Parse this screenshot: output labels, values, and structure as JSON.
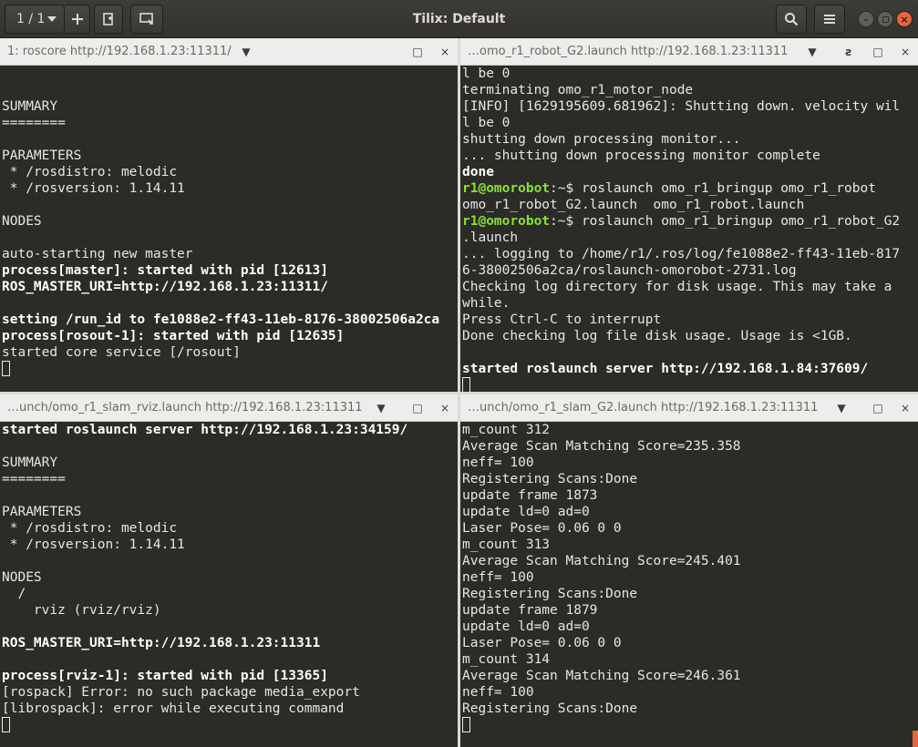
{
  "header": {
    "session_selector": "1 / 1",
    "title": "Tilix: Default"
  },
  "panes": {
    "top_left": {
      "title": "1: roscore http://192.168.1.23:11311/",
      "lines": [
        {
          "t": "",
          "s": ""
        },
        {
          "t": "",
          "s": ""
        },
        {
          "t": "SUMMARY",
          "s": ""
        },
        {
          "t": "========",
          "s": ""
        },
        {
          "t": "",
          "s": ""
        },
        {
          "t": "PARAMETERS",
          "s": ""
        },
        {
          "t": " * /rosdistro: melodic",
          "s": ""
        },
        {
          "t": " * /rosversion: 1.14.11",
          "s": ""
        },
        {
          "t": "",
          "s": ""
        },
        {
          "t": "NODES",
          "s": ""
        },
        {
          "t": "",
          "s": ""
        },
        {
          "t": "auto-starting new master",
          "s": ""
        },
        {
          "t": "process[master]: started with pid [12613]",
          "s": "b"
        },
        {
          "t": "ROS_MASTER_URI=http://192.168.1.23:11311/",
          "s": "b"
        },
        {
          "t": "",
          "s": ""
        },
        {
          "t": "setting /run_id to fe1088e2-ff43-11eb-8176-38002506a2ca",
          "s": "b"
        },
        {
          "t": "process[rosout-1]: started with pid [12635]",
          "s": "b"
        },
        {
          "t": "started core service [/rosout]",
          "s": ""
        }
      ]
    },
    "top_right": {
      "title": "…omo_r1_robot_G2.launch http://192.168.1.23:11311",
      "lines": [
        {
          "t": "l be 0",
          "s": ""
        },
        {
          "t": "terminating omo_r1_motor_node",
          "s": ""
        },
        {
          "t": "[INFO] [1629195609.681962]: Shutting down. velocity wil",
          "s": ""
        },
        {
          "t": "l be 0",
          "s": ""
        },
        {
          "t": "shutting down processing monitor...",
          "s": ""
        },
        {
          "t": "... shutting down processing monitor complete",
          "s": ""
        },
        {
          "t": "done",
          "s": "b"
        },
        {
          "p": "r1@omorobot",
          "t": ":~$ roslaunch omo_r1_bringup omo_r1_robot",
          "s": ""
        },
        {
          "t": "omo_r1_robot_G2.launch  omo_r1_robot.launch",
          "s": ""
        },
        {
          "p": "r1@omorobot",
          "t": ":~$ roslaunch omo_r1_bringup omo_r1_robot_G2",
          "s": ""
        },
        {
          "t": ".launch",
          "s": ""
        },
        {
          "t": "... logging to /home/r1/.ros/log/fe1088e2-ff43-11eb-817",
          "s": ""
        },
        {
          "t": "6-38002506a2ca/roslaunch-omorobot-2731.log",
          "s": ""
        },
        {
          "t": "Checking log directory for disk usage. This may take a",
          "s": ""
        },
        {
          "t": "while.",
          "s": ""
        },
        {
          "t": "Press Ctrl-C to interrupt",
          "s": ""
        },
        {
          "t": "Done checking log file disk usage. Usage is <1GB.",
          "s": ""
        },
        {
          "t": "",
          "s": ""
        },
        {
          "t": "started roslaunch server http://192.168.1.84:37609/",
          "s": "b"
        }
      ]
    },
    "bottom_left": {
      "title": "…unch/omo_r1_slam_rviz.launch http://192.168.1.23:11311",
      "lines": [
        {
          "t": "started roslaunch server http://192.168.1.23:34159/",
          "s": "b"
        },
        {
          "t": "",
          "s": ""
        },
        {
          "t": "SUMMARY",
          "s": ""
        },
        {
          "t": "========",
          "s": ""
        },
        {
          "t": "",
          "s": ""
        },
        {
          "t": "PARAMETERS",
          "s": ""
        },
        {
          "t": " * /rosdistro: melodic",
          "s": ""
        },
        {
          "t": " * /rosversion: 1.14.11",
          "s": ""
        },
        {
          "t": "",
          "s": ""
        },
        {
          "t": "NODES",
          "s": ""
        },
        {
          "t": "  /",
          "s": ""
        },
        {
          "t": "    rviz (rviz/rviz)",
          "s": ""
        },
        {
          "t": "",
          "s": ""
        },
        {
          "t": "ROS_MASTER_URI=http://192.168.1.23:11311",
          "s": "b"
        },
        {
          "t": "",
          "s": ""
        },
        {
          "t": "process[rviz-1]: started with pid [13365]",
          "s": "b"
        },
        {
          "t": "[rospack] Error: no such package media_export",
          "s": ""
        },
        {
          "t": "[librospack]: error while executing command",
          "s": ""
        }
      ]
    },
    "bottom_right": {
      "title": "…unch/omo_r1_slam_G2.launch http://192.168.1.23:11311",
      "lines": [
        {
          "t": "m_count 312",
          "s": ""
        },
        {
          "t": "Average Scan Matching Score=235.358",
          "s": ""
        },
        {
          "t": "neff= 100",
          "s": ""
        },
        {
          "t": "Registering Scans:Done",
          "s": ""
        },
        {
          "t": "update frame 1873",
          "s": ""
        },
        {
          "t": "update ld=0 ad=0",
          "s": ""
        },
        {
          "t": "Laser Pose= 0.06 0 0",
          "s": ""
        },
        {
          "t": "m_count 313",
          "s": ""
        },
        {
          "t": "Average Scan Matching Score=245.401",
          "s": ""
        },
        {
          "t": "neff= 100",
          "s": ""
        },
        {
          "t": "Registering Scans:Done",
          "s": ""
        },
        {
          "t": "update frame 1879",
          "s": ""
        },
        {
          "t": "update ld=0 ad=0",
          "s": ""
        },
        {
          "t": "Laser Pose= 0.06 0 0",
          "s": ""
        },
        {
          "t": "m_count 314",
          "s": ""
        },
        {
          "t": "Average Scan Matching Score=246.361",
          "s": ""
        },
        {
          "t": "neff= 100",
          "s": ""
        },
        {
          "t": "Registering Scans:Done",
          "s": ""
        }
      ]
    }
  },
  "icons": {
    "session_dropdown": "chevron-down-icon",
    "add_terminal": "plus-icon",
    "new_session": "new-session-icon",
    "sync_input": "sync-input-icon",
    "search": "search-icon",
    "menu": "hamburger-menu-icon",
    "pane_menu": "triangle-down-icon",
    "maximize": "maximize-icon",
    "close": "close-icon",
    "read_only": "read-only-icon"
  },
  "colors": {
    "terminal_bg": "#2b2b27",
    "prompt_green": "#8ae234",
    "accent_orange": "#e9643a"
  }
}
